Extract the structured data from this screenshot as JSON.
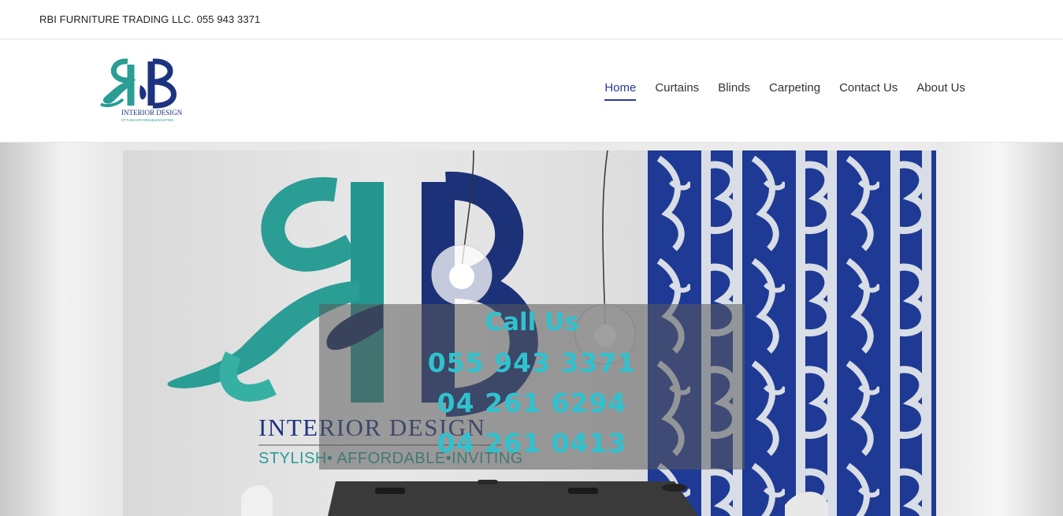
{
  "topbar": {
    "text": "RBI FURNITURE TRADING LLC. 055 943 3371"
  },
  "logo": {
    "line1": "INTERIOR DESIGN",
    "line2": "STYLISH•AFFORDABLE•INVITING"
  },
  "nav": {
    "items": [
      {
        "label": "Home",
        "active": true
      },
      {
        "label": "Curtains"
      },
      {
        "label": "Blinds"
      },
      {
        "label": "Carpeting"
      },
      {
        "label": "Contact Us"
      },
      {
        "label": "About Us"
      }
    ]
  },
  "hero": {
    "art_line1": "INTERIOR DESIGN",
    "art_line2": "STYLISH• AFFORDABLE•INVITING",
    "call_title": "Call Us",
    "phones": [
      "055 943 3371",
      "04 261 6294",
      "04 261 0413"
    ]
  },
  "colors": {
    "brand_teal": "#2a9d95",
    "brand_navy": "#1d3380",
    "accent_text": "#2fc2cf",
    "nav_active": "#2b3a9b"
  }
}
